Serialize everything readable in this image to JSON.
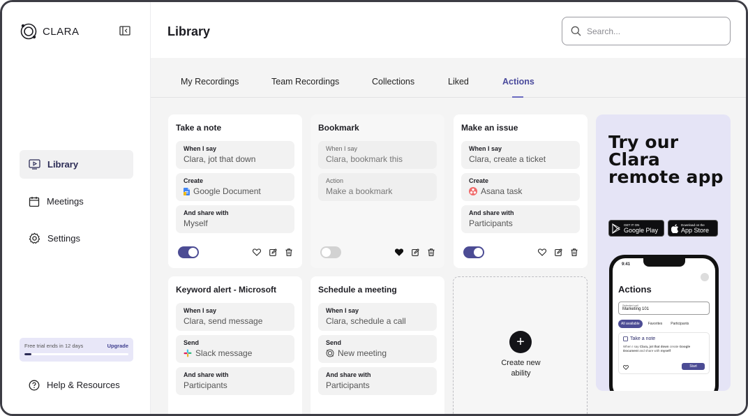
{
  "app": {
    "name": "CLARA"
  },
  "sidebar": {
    "items": [
      {
        "label": "Library",
        "icon": "play-screen-icon",
        "active": true
      },
      {
        "label": "Meetings",
        "icon": "calendar-icon"
      },
      {
        "label": "Settings",
        "icon": "gear-icon"
      }
    ],
    "trial": {
      "text": "Free trial ends in 12 days",
      "upgrade": "Upgrade",
      "progress": 0.07
    },
    "help": {
      "label": "Help & Resources",
      "icon": "help-icon"
    }
  },
  "header": {
    "title": "Library",
    "search_placeholder": "Search..."
  },
  "tabs": [
    {
      "label": "My Recordings"
    },
    {
      "label": "Team Recordings"
    },
    {
      "label": "Collections"
    },
    {
      "label": "Liked"
    },
    {
      "label": "Actions",
      "active": true
    }
  ],
  "cards": [
    {
      "title": "Take a note",
      "fields": [
        {
          "label": "When I say",
          "value": "Clara, jot that down"
        },
        {
          "label": "Create",
          "value": "Google Document",
          "icon": "google-docs-icon"
        },
        {
          "label": "And share with",
          "value": "Myself"
        }
      ],
      "enabled": true,
      "liked": false
    },
    {
      "title": "Bookmark",
      "fields": [
        {
          "label": "When I say",
          "value": "Clara, bookmark this"
        },
        {
          "label": "Action",
          "value": "Make a bookmark"
        }
      ],
      "enabled": false,
      "liked": true
    },
    {
      "title": "Make an issue",
      "fields": [
        {
          "label": "When I say",
          "value": "Clara, create a ticket"
        },
        {
          "label": "Create",
          "value": "Asana task",
          "icon": "asana-icon"
        },
        {
          "label": "And share with",
          "value": "Participants"
        }
      ],
      "enabled": true,
      "liked": false
    },
    {
      "title": "Keyword alert - Microsoft",
      "fields": [
        {
          "label": "When I say",
          "value": "Clara, send message"
        },
        {
          "label": "Send",
          "value": "Slack message",
          "icon": "slack-icon"
        },
        {
          "label": "And share with",
          "value": "Participants"
        }
      ],
      "enabled": true,
      "liked": false
    },
    {
      "title": "Schedule a meeting",
      "fields": [
        {
          "label": "When I say",
          "value": "Clara, schedule a call"
        },
        {
          "label": "Send",
          "value": "New meeting",
          "icon": "clara-logo-icon"
        },
        {
          "label": "And share with",
          "value": "Participants"
        }
      ],
      "enabled": true,
      "liked": false
    }
  ],
  "new_card": {
    "label_line1": "Create new",
    "label_line2": "ability"
  },
  "promo": {
    "title": "Try our Clara remote app",
    "google_play": {
      "small": "GET IT ON",
      "big": "Google Play"
    },
    "app_store": {
      "small": "Download on the",
      "big": "App Store"
    },
    "phone": {
      "time": "9:41",
      "title": "Actions",
      "select_label": "Selected call",
      "select_value": "Marketing 101",
      "tabs": [
        "All available",
        "Favorites",
        "Participants"
      ],
      "card_title": "Take a note",
      "card_desc_1": "When I say",
      "card_desc_2": "Clara, jot that down",
      "card_desc_3": "create",
      "card_desc_4": "Google Document",
      "card_desc_5": "and share with",
      "card_desc_6": "myself",
      "start": "Start"
    }
  }
}
